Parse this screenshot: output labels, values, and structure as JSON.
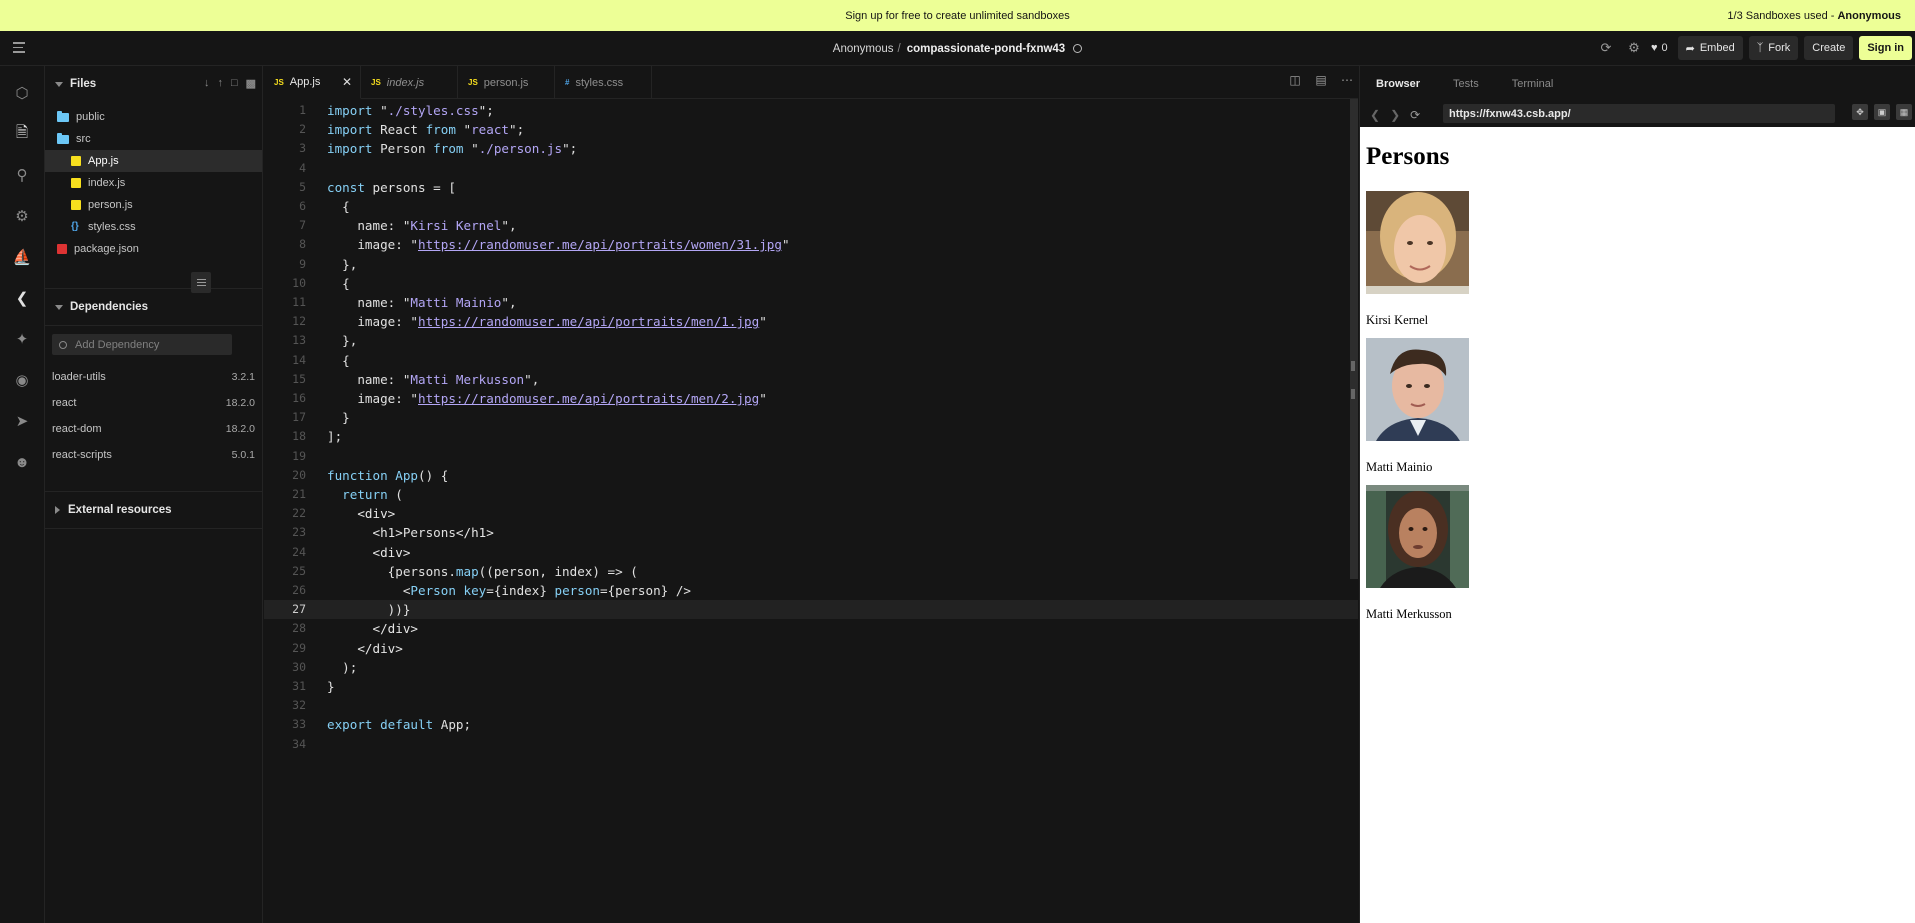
{
  "banner": {
    "text": "Sign up for free to create unlimited sandboxes",
    "usage": "1/3 Sandboxes used -",
    "user": "Anonymous"
  },
  "header": {
    "owner": "Anonymous",
    "separator": "/",
    "sandbox_name": "compassionate-pond-fxnw43",
    "likes": "0",
    "embed": "Embed",
    "fork": "Fork",
    "create": "Create",
    "signin": "Sign in"
  },
  "sidebar": {
    "files_title": "Files",
    "tree": [
      {
        "name": "public",
        "type": "folder"
      },
      {
        "name": "src",
        "type": "folder"
      },
      {
        "name": "App.js",
        "type": "js"
      },
      {
        "name": "index.js",
        "type": "js"
      },
      {
        "name": "person.js",
        "type": "js"
      },
      {
        "name": "styles.css",
        "type": "css"
      },
      {
        "name": "package.json",
        "type": "npm"
      }
    ],
    "deps_title": "Dependencies",
    "dep_placeholder": "Add Dependency",
    "deps": [
      {
        "name": "loader-utils",
        "version": "3.2.1"
      },
      {
        "name": "react",
        "version": "18.2.0"
      },
      {
        "name": "react-dom",
        "version": "18.2.0"
      },
      {
        "name": "react-scripts",
        "version": "5.0.1"
      }
    ],
    "external_title": "External resources"
  },
  "editor": {
    "tabs": [
      {
        "badge": "JS",
        "label": "App.js",
        "italic": false
      },
      {
        "badge": "JS",
        "label": "index.js",
        "italic": true
      },
      {
        "badge": "JS",
        "label": "person.js",
        "italic": false
      },
      {
        "badge": "#",
        "label": "styles.css",
        "italic": false
      }
    ],
    "current_line": 27,
    "line_numbers": [
      "1",
      "2",
      "3",
      "4",
      "5",
      "6",
      "7",
      "8",
      "9",
      "10",
      "11",
      "12",
      "13",
      "14",
      "15",
      "16",
      "17",
      "18",
      "19",
      "20",
      "21",
      "22",
      "23",
      "24",
      "25",
      "26",
      "27",
      "28",
      "29",
      "30",
      "31",
      "32",
      "33",
      "34"
    ],
    "code": [
      "import \"./styles.css\";",
      "import React from \"react\";",
      "import Person from \"./person.js\";",
      "",
      "const persons = [",
      "  {",
      "    name: \"Kirsi Kernel\",",
      "    image: \"https://randomuser.me/api/portraits/women/31.jpg\"",
      "  },",
      "  {",
      "    name: \"Matti Mainio\",",
      "    image: \"https://randomuser.me/api/portraits/men/1.jpg\"",
      "  },",
      "  {",
      "    name: \"Matti Merkusson\",",
      "    image: \"https://randomuser.me/api/portraits/men/2.jpg\"",
      "  }",
      "];",
      "",
      "function App() {",
      "  return (",
      "    <div>",
      "      <h1>Persons</h1>",
      "      <div>",
      "        {persons.map((person, index) => (",
      "          <Person key={index} person={person} />",
      "        ))}",
      "      </div>",
      "    </div>",
      "  );",
      "}",
      "",
      "export default App;",
      ""
    ]
  },
  "preview": {
    "tabs": [
      "Browser",
      "Tests",
      "Terminal"
    ],
    "url": "https://fxnw43.csb.app/",
    "heading": "Persons",
    "persons": [
      {
        "name": "Kirsi Kernel"
      },
      {
        "name": "Matti Mainio"
      },
      {
        "name": "Matti Merkusson"
      }
    ]
  }
}
